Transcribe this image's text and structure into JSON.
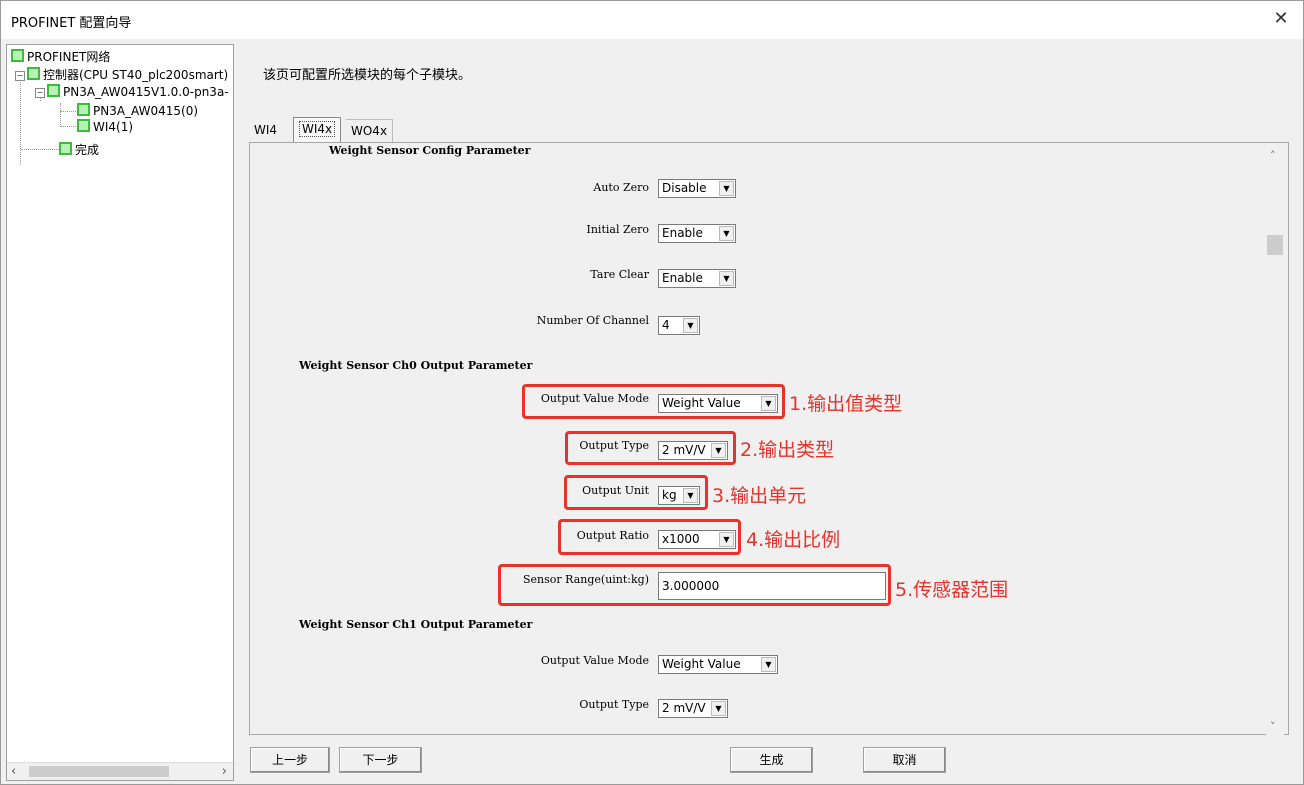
{
  "window": {
    "title": "PROFINET 配置向导",
    "close_label": "✕"
  },
  "tree": {
    "items": [
      {
        "label": "PROFINET网络"
      },
      {
        "label": "控制器(CPU ST40_plc200smart)",
        "expander": "−"
      },
      {
        "label": "PN3A_AW0415V1.0.0-pn3a-",
        "expander": "−"
      },
      {
        "label": "PN3A_AW0415(0)"
      },
      {
        "label": "WI4(1)"
      },
      {
        "label": "完成"
      }
    ],
    "scroll_left": "‹",
    "scroll_right": "›"
  },
  "intro": "该页可配置所选模块的每个子模块。",
  "tabs": [
    {
      "label": "WI4"
    },
    {
      "label": "WI4x",
      "selected": true
    },
    {
      "label": "WO4x"
    }
  ],
  "config": {
    "section_top": "Weight Sensor Config Parameter",
    "auto_zero": {
      "label": "Auto Zero",
      "value": "Disable"
    },
    "initial_zero": {
      "label": "Initial Zero",
      "value": "Enable"
    },
    "tare_clear": {
      "label": "Tare Clear",
      "value": "Enable"
    },
    "num_channel": {
      "label": "Number Of Channel",
      "value": "4"
    },
    "section_ch0": "Weight Sensor Ch0 Output Parameter",
    "ch0": {
      "output_value_mode": {
        "label": "Output Value Mode",
        "value": "Weight Value"
      },
      "output_type": {
        "label": "Output Type",
        "value": "2 mV/V"
      },
      "output_unit": {
        "label": "Output Unit",
        "value": "kg"
      },
      "output_ratio": {
        "label": "Output Ratio",
        "value": "x1000"
      },
      "sensor_range": {
        "label": "Sensor Range(uint:kg)",
        "value": "3.000000"
      }
    },
    "section_ch1": "Weight Sensor Ch1 Output Parameter",
    "ch1": {
      "output_value_mode": {
        "label": "Output Value Mode",
        "value": "Weight Value"
      },
      "output_type": {
        "label": "Output Type",
        "value": "2 mV/V"
      }
    }
  },
  "annotations": [
    "1.输出值类型",
    "2.输出类型",
    "3.输出单元",
    "4.输出比例",
    "5.传感器范围"
  ],
  "buttons": {
    "prev": "上一步",
    "next": "下一步",
    "generate": "生成",
    "cancel": "取消"
  },
  "colors": {
    "annotation_red": "#e8322a",
    "tree_green": "#3cbb3c"
  },
  "icons": {
    "combo_arrow": "▼",
    "scroll_up": "˄",
    "scroll_down": "˅"
  }
}
